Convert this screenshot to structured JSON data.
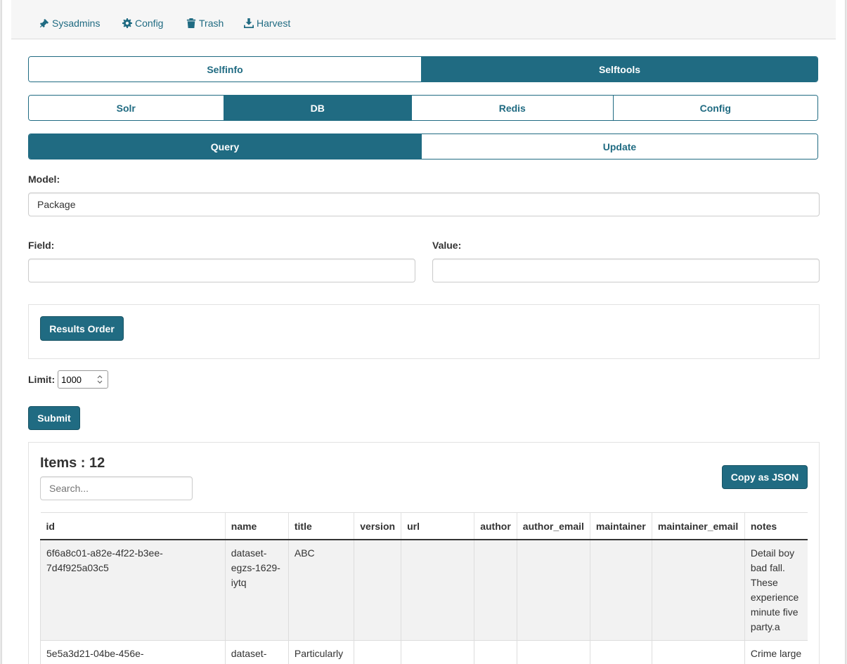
{
  "topnav": {
    "items": [
      {
        "label": "Sysadmins",
        "icon": "gavel-icon"
      },
      {
        "label": "Config",
        "icon": "gear-icon"
      },
      {
        "label": "Trash",
        "icon": "trash-icon"
      },
      {
        "label": "Harvest",
        "icon": "download-icon"
      }
    ]
  },
  "tabs_main": {
    "items": [
      "Selfinfo",
      "Selftools"
    ],
    "active": "Selftools"
  },
  "tabs_tools": {
    "items": [
      "Solr",
      "DB",
      "Redis",
      "Config"
    ],
    "active": "DB"
  },
  "tabs_db": {
    "items": [
      "Query",
      "Update"
    ],
    "active": "Query"
  },
  "form": {
    "model_label": "Model:",
    "model_value": "Package",
    "field_label": "Field:",
    "field_value": "",
    "value_label": "Value:",
    "value_value": "",
    "results_order_label": "Results Order",
    "limit_label": "Limit:",
    "limit_value": "1000",
    "submit_label": "Submit"
  },
  "results": {
    "title": "Items : 12",
    "search_placeholder": "Search...",
    "copy_json_label": "Copy as JSON",
    "columns": [
      "id",
      "name",
      "title",
      "version",
      "url",
      "author",
      "author_email",
      "maintainer",
      "maintainer_email",
      "notes"
    ],
    "rows": [
      {
        "id": "6f6a8c01-a82e-4f22-b3ee-7d4f925a03c5",
        "name": "dataset-egzs-1629-iytq",
        "title": "ABC",
        "version": "",
        "url": "",
        "author": "",
        "author_email": "",
        "maintainer": "",
        "maintainer_email": "",
        "notes": "Detail boy bad fall. These experience minute five party.a"
      },
      {
        "id": "5e5a3d21-04be-456e-",
        "name": "dataset-",
        "title": "Particularly",
        "version": "",
        "url": "",
        "author": "",
        "author_email": "",
        "maintainer": "",
        "maintainer_email": "",
        "notes": "Crime large"
      }
    ]
  },
  "colors": {
    "accent": "#206b82"
  }
}
